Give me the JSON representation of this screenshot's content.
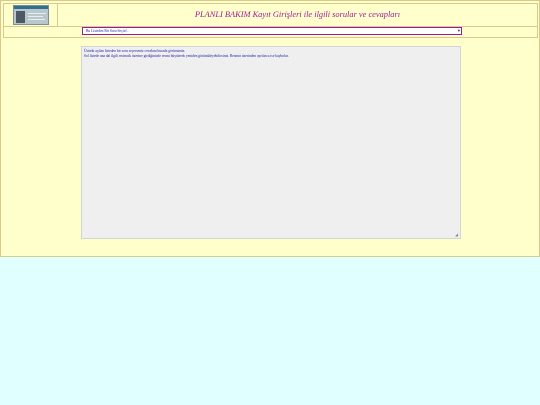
{
  "header": {
    "title": "PLANLI BAKIM Kayıt Girişleri ile ilgili sorular ve cevapları"
  },
  "question_select": {
    "selected": "Bu Listeden Bir Soru Seçin!.."
  },
  "answer": {
    "lines": [
      "Üstteki açılan listeden bir soru seçerseniz cevabını burada görürsünüz.",
      "Sol listede ana dal ilgili resimcik üzerine girdiğinizde resmi büyüterek yeniden görüntüleyebilirsiniz. Resmin üzerinden ayrılınca ise kaybolur."
    ]
  },
  "colors": {
    "page_background": "#e0ffff",
    "panel_background": "#ffffcc",
    "title_color": "#a0189b",
    "text_color": "#1a1aa0",
    "answer_background": "#efefef"
  }
}
